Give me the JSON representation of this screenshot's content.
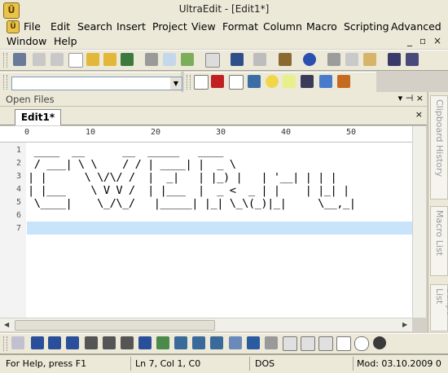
{
  "window": {
    "title": "UltraEdit - [Edit1*]"
  },
  "menu": {
    "items": [
      "File",
      "Edit",
      "Search",
      "Insert",
      "Project",
      "View",
      "Format",
      "Column",
      "Macro",
      "Scripting",
      "Advanced",
      "Window",
      "Help"
    ],
    "mdi_controls": [
      "_",
      "▫",
      "×"
    ]
  },
  "panel": {
    "title": "Open Files",
    "pin_icons": "▾ ⊣ ×"
  },
  "tab": {
    "label": "Edit1*",
    "close": "×"
  },
  "ruler": {
    "labels": [
      "0",
      "10",
      "20",
      "30",
      "40",
      "50"
    ]
  },
  "editor": {
    "line_numbers": [
      "1",
      "2",
      "3",
      "4",
      "5",
      "6",
      "7"
    ],
    "lines": [
      " ____  __      __  _____   ____",
      " / ___| \\ \\    / / | ____| |  _ \\",
      "| |      \\ \\/\\/ /  |  _|   | |_) |   | '__| | | |",
      "| |___    \\ V V /  | |___  |  _ <  _ | |    | |_| |",
      " \\____|    \\_/\\_/   |_____| |_| \\_\\(_)|_|     \\__,_|",
      "",
      ""
    ],
    "current_line": "7"
  },
  "sidebar": {
    "tabs": [
      "Clipboard History",
      "Macro List",
      "Script List"
    ]
  },
  "status": {
    "help": "For Help, press F1",
    "position": "Ln 7, Col 1, C0",
    "format": "DOS",
    "modified": "Mod: 03.10.2009 0"
  },
  "icons": {
    "toolbar1": [
      "new-project-icon",
      "back-icon",
      "forward-icon",
      "new-file-icon",
      "open-file-icon",
      "open-folder-icon",
      "save-icon",
      "print-icon",
      "print-preview-icon",
      "spell-check-icon",
      "properties-icon",
      "word-wrap-icon",
      "hex-mode-icon",
      "column-mode-icon",
      "internet-icon",
      "cut-icon",
      "copy-icon",
      "paste-icon",
      "find-icon",
      "find-next-icon"
    ],
    "toolbar2": [
      "google-icon",
      "yahoo-icon",
      "wikipedia-icon",
      "msdn-icon",
      "idea-icon",
      "php-icon",
      "code-icon",
      "windows-icon"
    ],
    "bottom_toolbar": [
      "html-icon",
      "bold-icon",
      "italic-icon",
      "underline-icon",
      "align-icon",
      "list-icon",
      "ordered-list-icon",
      "font-icon",
      "image-icon",
      "indent-icon",
      "outdent-icon",
      "paragraph-icon",
      "table-icon",
      "hr-icon",
      "form-icon",
      "textfield-icon",
      "textarea-icon",
      "button-icon",
      "checkbox-icon",
      "radio-icon",
      "record-icon"
    ]
  }
}
